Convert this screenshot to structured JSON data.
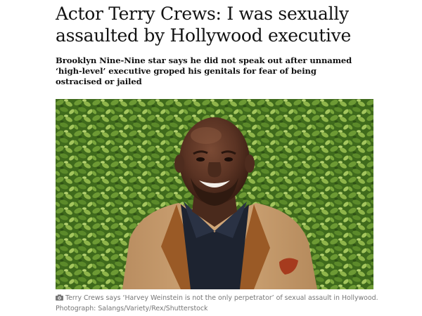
{
  "article": {
    "headline": "Actor Terry Crews: I was sexually assaulted by Hollywood executive",
    "standfirst": "Brooklyn Nine-Nine star says he did not speak out after unnamed ‘high-level’ executive groped his genitals for fear of being ostracised or jailed",
    "image": {
      "alt": "Terry Crews smiling in front of a green hedge wall",
      "icon": "camera-icon",
      "caption": "Terry Crews says ‘Harvey Weinstein is not the only perpetrator’ of sexual assault in Hollywood.",
      "credit": "Photograph: Salangs/Variety/Rex/Shutterstock"
    }
  },
  "colors": {
    "text": "#121212",
    "caption": "#767676",
    "hedge": "#4f7a26",
    "jacket": "#c49a6c",
    "shirt": "#1d2330"
  }
}
